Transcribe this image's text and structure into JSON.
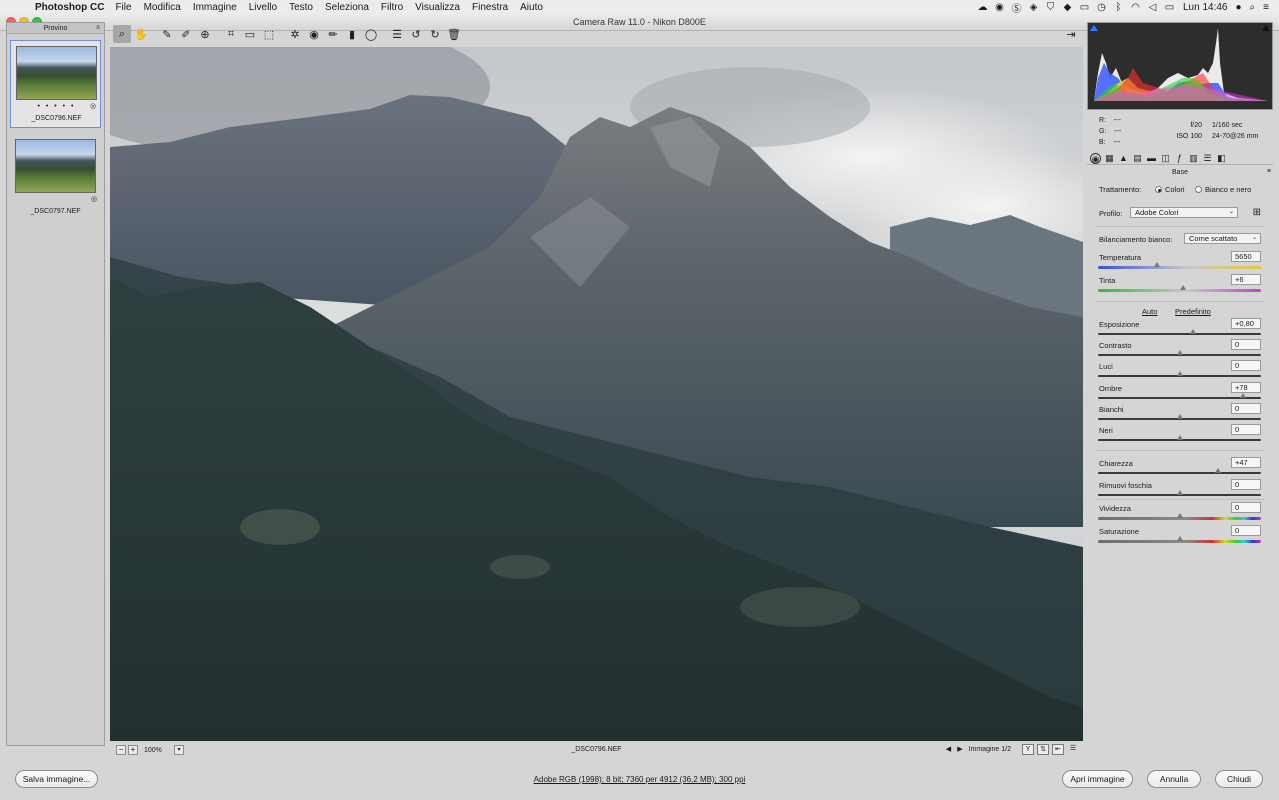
{
  "menubar": {
    "apple_glyph": "",
    "app_name": "Photoshop CC",
    "items": [
      "File",
      "Modifica",
      "Immagine",
      "Livello",
      "Testo",
      "Seleziona",
      "Filtro",
      "Visualizza",
      "Finestra",
      "Aiuto"
    ],
    "clock": "Lun 14:46"
  },
  "window": {
    "title": "Camera Raw 11.0  -  Nikon D800E"
  },
  "filmstrip": {
    "header": "Provino",
    "thumbnails": [
      {
        "filename": "_DSC0796.NEF",
        "stars": "• • • • •",
        "selected": true
      },
      {
        "filename": "_DSC0797.NEF",
        "stars": "",
        "selected": false
      }
    ]
  },
  "preview": {
    "filename": "_DSC0796.NEF",
    "zoom": "100%",
    "image_counter": "Immagine 1/2",
    "view_y_label": "Y"
  },
  "readout": {
    "r_label": "R:",
    "g_label": "G:",
    "b_label": "B:",
    "r_value": "---",
    "g_value": "---",
    "b_value": "---",
    "aperture": "f/20",
    "shutter": "1/160 sec",
    "iso": "ISO 100",
    "lens": "24-70@26 mm"
  },
  "panel": {
    "title": "Base",
    "treatment_label": "Trattamento:",
    "treatment_color": "Colori",
    "treatment_bw": "Bianco e nero",
    "profile_label": "Profilo:",
    "profile_value": "Adobe Colori",
    "wb_label": "Bilanciamento bianco:",
    "wb_value": "Come scattato",
    "auto_link": "Auto",
    "default_link": "Predefinito",
    "sliders": {
      "temperatura": {
        "label": "Temperatura",
        "value": "5650",
        "position": 0.36
      },
      "tinta": {
        "label": "Tinta",
        "value": "+6",
        "position": 0.52
      },
      "esposizione": {
        "label": "Esposizione",
        "value": "+0,80",
        "position": 0.58
      },
      "contrasto": {
        "label": "Contrasto",
        "value": "0",
        "position": 0.5
      },
      "luci": {
        "label": "Luci",
        "value": "0",
        "position": 0.5
      },
      "ombre": {
        "label": "Ombre",
        "value": "+78",
        "position": 0.89
      },
      "bianchi": {
        "label": "Bianchi",
        "value": "0",
        "position": 0.5
      },
      "neri": {
        "label": "Neri",
        "value": "0",
        "position": 0.5
      },
      "chiarezza": {
        "label": "Chiarezza",
        "value": "+47",
        "position": 0.735
      },
      "foschia": {
        "label": "Rimuovi foschia",
        "value": "0",
        "position": 0.5
      },
      "vividezza": {
        "label": "Vividezza",
        "value": "0",
        "position": 0.5
      },
      "saturazione": {
        "label": "Saturazione",
        "value": "0",
        "position": 0.5
      }
    }
  },
  "bottom": {
    "save_label": "Salva immagine...",
    "workflow_text": "Adobe RGB (1998); 8 bit; 7360 per 4912 (36,2 MB); 300 ppi",
    "open_label": "Apri immagine",
    "cancel_label": "Annulla",
    "close_label": "Chiudi"
  },
  "colors": {
    "histogram_bg": "#2d2d2d",
    "selection_border": "#6c8fd8"
  }
}
